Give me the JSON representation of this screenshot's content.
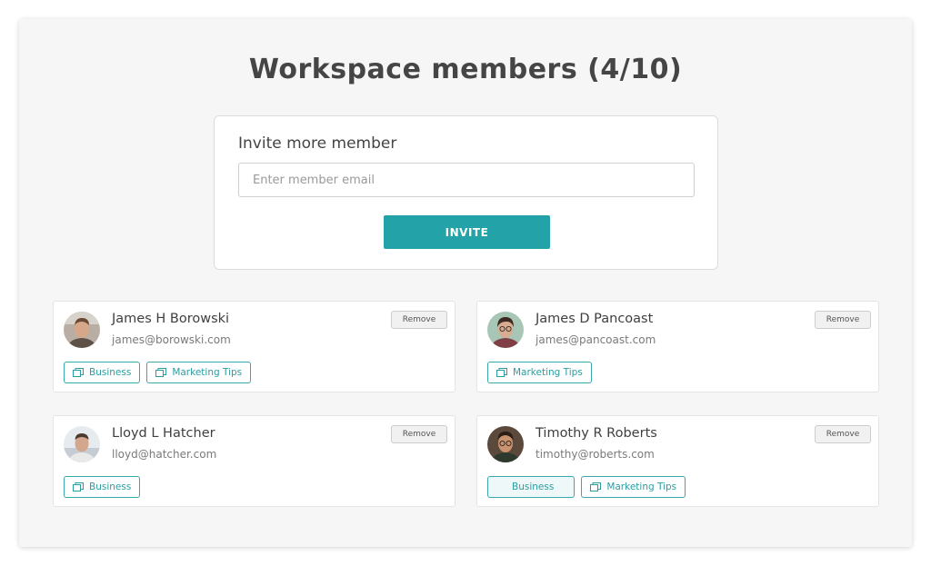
{
  "header": {
    "title": "Workspace members (4/10)"
  },
  "invite": {
    "title": "Invite more member",
    "placeholder": "Enter member email",
    "value": "",
    "button_label": "INVITE"
  },
  "colors": {
    "accent": "#23a3a8",
    "tag_border": "#3aa9ad"
  },
  "members": [
    {
      "name": "James H Borowski",
      "email": "james@borowski.com",
      "remove_label": "Remove",
      "tags": [
        "Business",
        "Marketing Tips"
      ]
    },
    {
      "name": "James D Pancoast",
      "email": "james@pancoast.com",
      "remove_label": "Remove",
      "tags": [
        "Marketing Tips"
      ]
    },
    {
      "name": "Lloyd L Hatcher",
      "email": "lloyd@hatcher.com",
      "remove_label": "Remove",
      "tags": [
        "Business"
      ]
    },
    {
      "name": "Timothy R Roberts",
      "email": "timothy@roberts.com",
      "remove_label": "Remove",
      "tags": [
        "Business",
        "Marketing Tips"
      ]
    }
  ],
  "icons": {
    "tag": "folder-icon"
  }
}
